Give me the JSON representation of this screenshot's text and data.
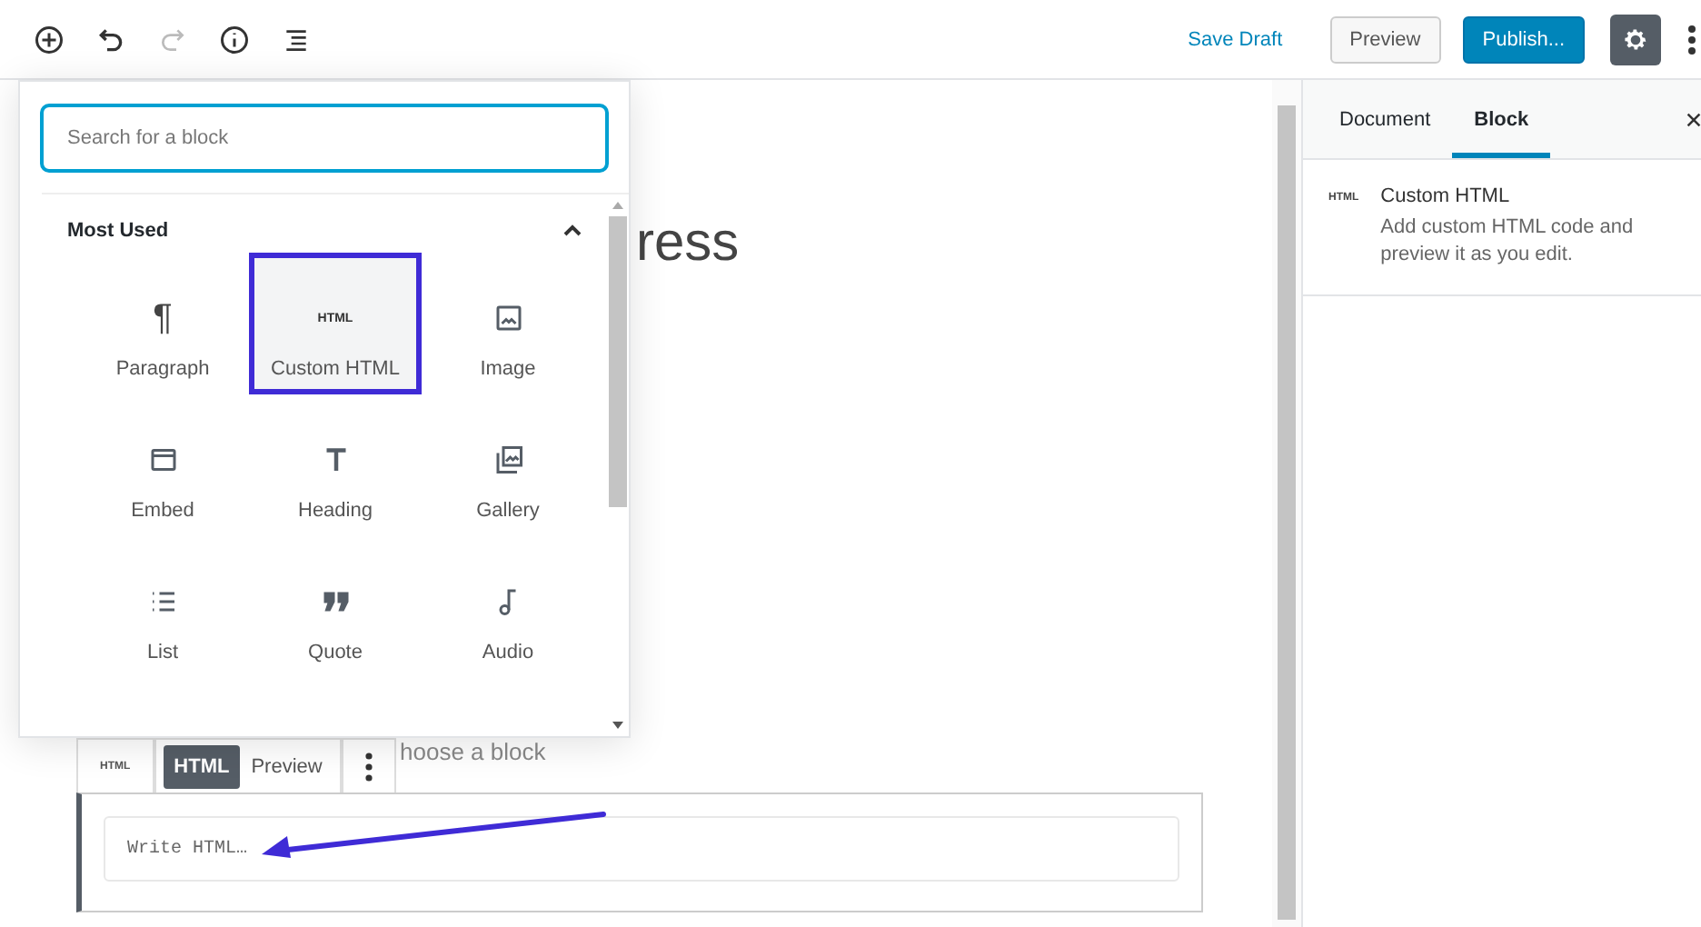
{
  "header": {
    "save_draft": "Save Draft",
    "preview": "Preview",
    "publish": "Publish..."
  },
  "editor": {
    "title_fragment": "ress",
    "appender_fragment": "hoose a block",
    "block": {
      "type_icon": "HTML",
      "tabs": [
        {
          "label": "HTML",
          "selected": true
        },
        {
          "label": "Preview",
          "selected": false
        }
      ],
      "placeholder": "Write HTML…"
    }
  },
  "inserter": {
    "search_placeholder": "Search for a block",
    "section": "Most Used",
    "expanded": true,
    "items": [
      {
        "label": "Paragraph",
        "kind": "paragraph",
        "icon_text": "¶",
        "selected": false
      },
      {
        "label": "Custom HTML",
        "kind": "html",
        "icon_text": "HTML",
        "selected": true
      },
      {
        "label": "Image",
        "kind": "image",
        "selected": false
      },
      {
        "label": "Embed",
        "kind": "embed",
        "selected": false
      },
      {
        "label": "Heading",
        "kind": "heading",
        "selected": false
      },
      {
        "label": "Gallery",
        "kind": "gallery",
        "selected": false
      },
      {
        "label": "List",
        "kind": "list",
        "selected": false
      },
      {
        "label": "Quote",
        "kind": "quote",
        "selected": false
      },
      {
        "label": "Audio",
        "kind": "audio",
        "selected": false
      }
    ]
  },
  "sidebar": {
    "tabs": [
      {
        "label": "Document",
        "selected": false
      },
      {
        "label": "Block",
        "selected": true
      }
    ],
    "card": {
      "icon_text": "HTML",
      "title": "Custom HTML",
      "description": "Add custom HTML code and preview it as you edit."
    }
  }
}
